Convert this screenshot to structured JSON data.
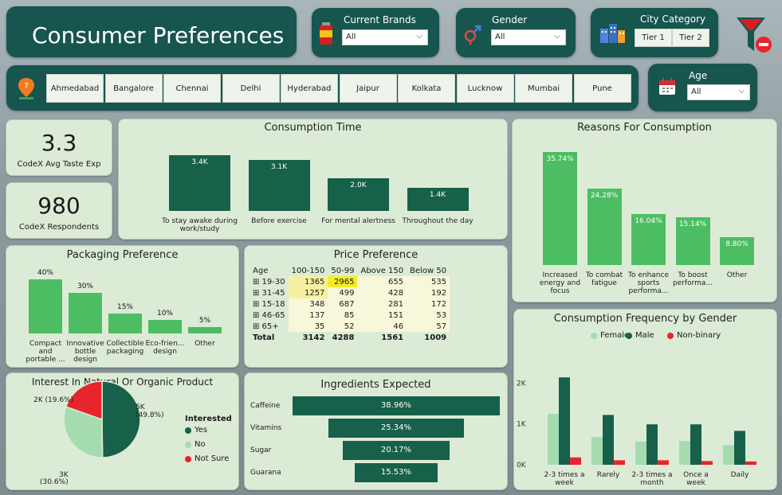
{
  "header": {
    "title": "Consumer Preferences"
  },
  "filters": {
    "brands": {
      "label": "Current Brands",
      "value": "All"
    },
    "gender": {
      "label": "Gender",
      "value": "All"
    },
    "city_category": {
      "label": "City Category",
      "options": [
        "Tier 1",
        "Tier 2"
      ]
    },
    "age": {
      "label": "Age",
      "value": "All"
    }
  },
  "cities": [
    "Ahmedabad",
    "Bangalore",
    "Chennai",
    "Delhi",
    "Hyderabad",
    "Jaipur",
    "Kolkata",
    "Lucknow",
    "Mumbai",
    "Pune"
  ],
  "kpis": {
    "taste_value": "3.3",
    "taste_label": "CodeX Avg Taste Exp",
    "respondents_value": "980",
    "respondents_label": "CodeX Respondents"
  },
  "colors": {
    "dark_green": "#17604a",
    "green": "#4cbd63",
    "light_green": "#a4dcb0",
    "red": "#e8252b",
    "card": "#dcebd6",
    "header": "#17554f"
  },
  "consumption_time": {
    "title": "Consumption Time",
    "type": "bar",
    "categories": [
      "To stay awake during work/study",
      "Before exercise",
      "For mental alertness",
      "Throughout the day"
    ],
    "values": [
      3.4,
      3.1,
      2.0,
      1.4
    ],
    "labels": [
      "3.4K",
      "3.1K",
      "2.0K",
      "1.4K"
    ]
  },
  "reasons": {
    "title": "Reasons For Consumption",
    "type": "bar",
    "categories": [
      "Increased energy and focus",
      "To combat fatigue",
      "To enhance sports performa...",
      "To boost performa...",
      "Other"
    ],
    "values": [
      35.74,
      24.28,
      16.04,
      15.14,
      8.8
    ],
    "labels": [
      "35.74%",
      "24.28%",
      "16.04%",
      "15.14%",
      "8.80%"
    ]
  },
  "packaging": {
    "title": "Packaging Preference",
    "type": "bar",
    "categories": [
      "Compact and portable ...",
      "Innovative bottle design",
      "Collectible packaging",
      "Eco-frien... design",
      "Other"
    ],
    "values": [
      40,
      30,
      15,
      10,
      5
    ],
    "labels": [
      "40%",
      "30%",
      "15%",
      "10%",
      "5%"
    ]
  },
  "price": {
    "title": "Price Preference",
    "headers": [
      "Age",
      "100-150",
      "50-99",
      "Above 150",
      "Below 50"
    ],
    "rows": [
      [
        "19-30",
        "1365",
        "2965",
        "655",
        "535"
      ],
      [
        "31-45",
        "1257",
        "499",
        "428",
        "192"
      ],
      [
        "15-18",
        "348",
        "687",
        "281",
        "172"
      ],
      [
        "46-65",
        "137",
        "85",
        "151",
        "53"
      ],
      [
        "65+",
        "35",
        "52",
        "46",
        "57"
      ]
    ],
    "total": [
      "Total",
      "3142",
      "4288",
      "1561",
      "1009"
    ]
  },
  "organic": {
    "title": "Interest In Natural Or Organic Product",
    "legend_title": "Interested",
    "type": "pie",
    "slices": [
      {
        "name": "Yes",
        "value": 49.8,
        "label": "5K",
        "pct": "(49.8%)"
      },
      {
        "name": "No",
        "value": 30.6,
        "label": "3K",
        "pct": "(30.6%)"
      },
      {
        "name": "Not Sure",
        "value": 19.6,
        "label": "2K (19.6%)",
        "pct": ""
      }
    ]
  },
  "ingredients": {
    "title": "Ingredients Expected",
    "type": "bar",
    "categories": [
      "Caffeine",
      "Vitamins",
      "Sugar",
      "Guarana"
    ],
    "values": [
      38.96,
      25.34,
      20.17,
      15.53
    ],
    "labels": [
      "38.96%",
      "25.34%",
      "20.17%",
      "15.53%"
    ]
  },
  "frequency": {
    "title": "Consumption Frequency by Gender",
    "type": "bar",
    "categories": [
      "2-3 times a week",
      "Rarely",
      "2-3 times a month",
      "Once a week",
      "Daily"
    ],
    "series": [
      {
        "name": "Female",
        "values": [
          1250,
          680,
          570,
          580,
          480
        ]
      },
      {
        "name": "Male",
        "values": [
          2140,
          1220,
          990,
          990,
          830
        ]
      },
      {
        "name": "Non-binary",
        "values": [
          180,
          110,
          110,
          90,
          80
        ]
      }
    ],
    "yticks": [
      "0K",
      "1K",
      "2K"
    ],
    "ylim": [
      0,
      2300
    ]
  }
}
